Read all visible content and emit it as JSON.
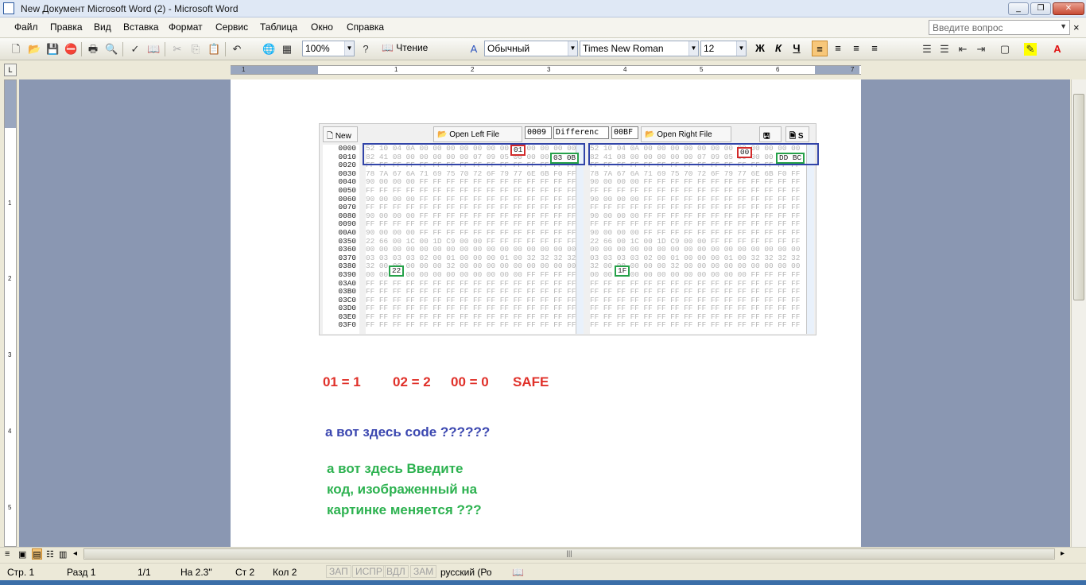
{
  "window": {
    "title": "New Документ Microsoft Word (2) - Microsoft Word",
    "minimize": "_",
    "restore": "❐",
    "close": "✕"
  },
  "menu": {
    "items": [
      "Файл",
      "Правка",
      "Вид",
      "Вставка",
      "Формат",
      "Сервис",
      "Таблица",
      "Окно",
      "Справка"
    ],
    "help_placeholder": "Введите вопрос",
    "close_doc": "×"
  },
  "toolbar": {
    "zoom": "100%",
    "read_label": "Чтение",
    "style": "Обычный",
    "font": "Times New Roman",
    "size": "12",
    "bold": "Ж",
    "italic": "К",
    "underline": "Ч",
    "align_left": "≡",
    "align_center": "≡",
    "align_right": "≡",
    "justify": "≡"
  },
  "ruler": {
    "numbers": [
      "1",
      "1",
      "2",
      "3",
      "4",
      "5",
      "6",
      "7"
    ],
    "vnumbers": [
      "1",
      "2",
      "3",
      "4",
      "5"
    ],
    "corner": "L"
  },
  "hex_compare": {
    "new_label": "New",
    "open_left": "Open Left File",
    "open_right": "Open Right File",
    "offset_field": "0009",
    "difference_field": "Differenc",
    "right_field": "00BF",
    "h_label": "H",
    "s_label": "S",
    "addresses": [
      "0000",
      "0010",
      "0020",
      "0030",
      "0040",
      "0050",
      "0060",
      "0070",
      "0080",
      "0090",
      "00A0",
      "0350",
      "0360",
      "0370",
      "0380",
      "0390",
      "03A0",
      "03B0",
      "03C0",
      "03D0",
      "03E0",
      "03F0"
    ],
    "left_lines": [
      "52 10 04 0A 00 00 00 00 00 00 00 00 00 00 00 00",
      "82 41 08 00 00 00 00 00 07 09 05 00 00 00 00 00",
      "FF FF FF FF FF FF FF FF FF FF FF FF FF FF FF FF",
      "78 7A 67 6A 71 69 75 70 72 6F 79 77 6E 6B F0 FF",
      "90 00 00 00 FF FF FF FF FF FF FF FF FF FF FF FF",
      "FF FF FF FF FF FF FF FF FF FF FF FF FF FF FF FF",
      "90 00 00 00 FF FF FF FF FF FF FF FF FF FF FF FF",
      "FF FF FF FF FF FF FF FF FF FF FF FF FF FF FF FF",
      "90 00 00 00 FF FF FF FF FF FF FF FF FF FF FF FF",
      "FF FF FF FF FF FF FF FF FF FF FF FF FF FF FF FF",
      "90 00 00 00 FF FF FF FF FF FF FF FF FF FF FF FF",
      "22 66 00 1C 00 1D C9 00 00 FF FF FF FF FF FF FF",
      "00 00 00 00 00 00 00 00 00 00 00 00 00 00 00 00",
      "03 03 03 03 02 00 01 00 00 00 01 00 32 32 32 32",
      "32 00 00 00 00 00 32 00 00 00 00 00 00 00 00 00",
      "00 00 00 00 00 00 00 00 00 00 00 00 FF FF FF FF",
      "FF FF FF FF FF FF FF FF FF FF FF FF FF FF FF FF",
      "FF FF FF FF FF FF FF FF FF FF FF FF FF FF FF FF",
      "FF FF FF FF FF FF FF FF FF FF FF FF FF FF FF FF",
      "FF FF FF FF FF FF FF FF FF FF FF FF FF FF FF FF",
      "FF FF FF FF FF FF FF FF FF FF FF FF FF FF FF FF",
      "FF FF FF FF FF FF FF FF FF FF FF FF FF FF FF FF"
    ],
    "right_lines": [
      "52 10 04 0A 00 00 00 00 00 00 00 00 00 00 00 00",
      "82 41 08 00 00 00 00 00 07 09 05 00 00 00 00 00",
      "FF FF FF FF FF FF FF FF FF FF FF FF FF FF FF FF",
      "78 7A 67 6A 71 69 75 70 72 6F 79 77 6E 6B F0 FF",
      "90 00 00 00 FF FF FF FF FF FF FF FF FF FF FF FF",
      "FF FF FF FF FF FF FF FF FF FF FF FF FF FF FF FF",
      "90 00 00 00 FF FF FF FF FF FF FF FF FF FF FF FF",
      "FF FF FF FF FF FF FF FF FF FF FF FF FF FF FF FF",
      "90 00 00 00 FF FF FF FF FF FF FF FF FF FF FF FF",
      "FF FF FF FF FF FF FF FF FF FF FF FF FF FF FF FF",
      "90 00 00 00 FF FF FF FF FF FF FF FF FF FF FF FF",
      "22 66 00 1C 00 1D C9 00 00 FF FF FF FF FF FF FF",
      "00 00 00 00 00 00 00 00 00 00 00 00 00 00 00 00",
      "03 03 03 03 02 00 01 00 00 00 01 00 32 32 32 32",
      "32 00 00 00 00 00 32 00 00 00 00 00 00 00 00 00",
      "00 00 00 00 00 00 00 00 00 00 00 00 FF FF FF FF",
      "FF FF FF FF FF FF FF FF FF FF FF FF FF FF FF FF",
      "FF FF FF FF FF FF FF FF FF FF FF FF FF FF FF FF",
      "FF FF FF FF FF FF FF FF FF FF FF FF FF FF FF FF",
      "FF FF FF FF FF FF FF FF FF FF FF FF FF FF FF FF",
      "FF FF FF FF FF FF FF FF FF FF FF FF FF FF FF FF",
      "FF FF FF FF FF FF FF FF FF FF FF FF FF FF FF FF"
    ],
    "marks": {
      "left_red": "01",
      "left_green": "03 0B",
      "left_22": "22",
      "right_red": "00",
      "right_green": "DD BC",
      "right_1f": "1F"
    }
  },
  "notes": {
    "values": [
      "01 = 1",
      "02 = 2",
      "00 = 0",
      "SAFE"
    ],
    "blue_line": "а вот здесь  code ??????",
    "green_lines": [
      "а вот здесь Введите",
      "код, изображенный на",
      "картинке меняется ???"
    ]
  },
  "status": {
    "page": "Стр. 1",
    "section": "Разд  1",
    "pages": "1/1",
    "at": "На  2.3\"",
    "line": "Ст  2",
    "col": "Кол  2",
    "rec": "ЗАП",
    "trk": "ИСПР",
    "ext": "ВДЛ",
    "ovr": "ЗАМ",
    "lang": "русский (Ро"
  },
  "colors": {
    "red": "#e0312a",
    "blue": "#3b47b0",
    "green": "#2db250",
    "page_bg": "#ffffff",
    "workspace": "#8a97b2"
  }
}
